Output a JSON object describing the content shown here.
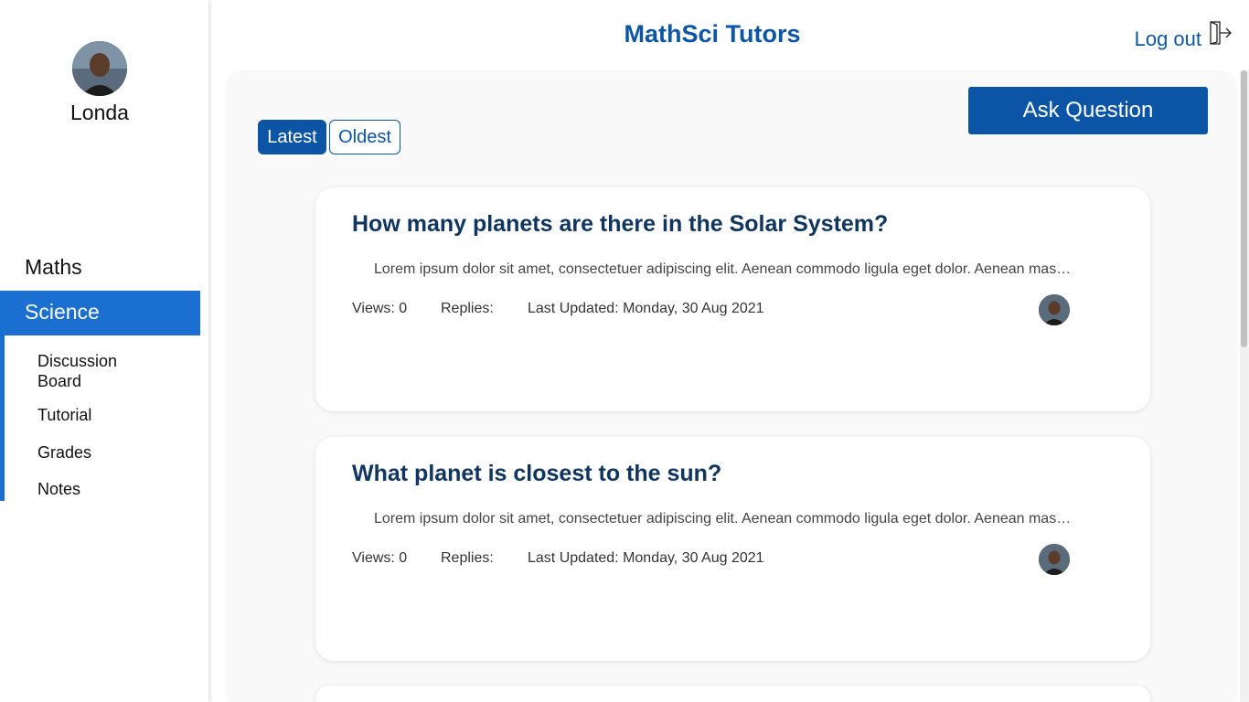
{
  "app": {
    "title": "MathSci Tutors",
    "logout_label": "Log out"
  },
  "user": {
    "name": "Londa"
  },
  "sidebar": {
    "items": [
      {
        "label": "Maths"
      },
      {
        "label": "Science"
      }
    ],
    "subitems": [
      {
        "label": "Discussion Board"
      },
      {
        "label": "Tutorial"
      },
      {
        "label": "Grades"
      },
      {
        "label": "Notes"
      }
    ]
  },
  "toolbar": {
    "ask_label": "Ask Question",
    "sort_tabs": [
      {
        "label": "Latest"
      },
      {
        "label": "Oldest"
      }
    ]
  },
  "posts": [
    {
      "title": "How many planets are there in the Solar System?",
      "excerpt": "Lorem ipsum dolor sit amet, consectetuer adipiscing elit. Aenean commodo ligula eget dolor. Aenean massa. Cum sociis natoque penatibus et magnis dis parturient montes.",
      "views": "Views: 0",
      "replies": "Replies:",
      "updated": "Last Updated: Monday, 30 Aug 2021"
    },
    {
      "title": "What planet is closest to the sun?",
      "excerpt": "Lorem ipsum dolor sit amet, consectetuer adipiscing elit. Aenean commodo ligula eget dolor. Aenean massa. Cum sociis natoque penatibus et magnis dis parturient montes.",
      "views": "Views: 0",
      "replies": "Replies:",
      "updated": "Last Updated: Monday, 30 Aug 2021"
    }
  ],
  "colors": {
    "accent": "#0b54a6",
    "nav_active": "#1a6fd1",
    "title": "#0f3560"
  },
  "icons": {
    "logout": "logout-icon",
    "avatar": "avatar"
  }
}
